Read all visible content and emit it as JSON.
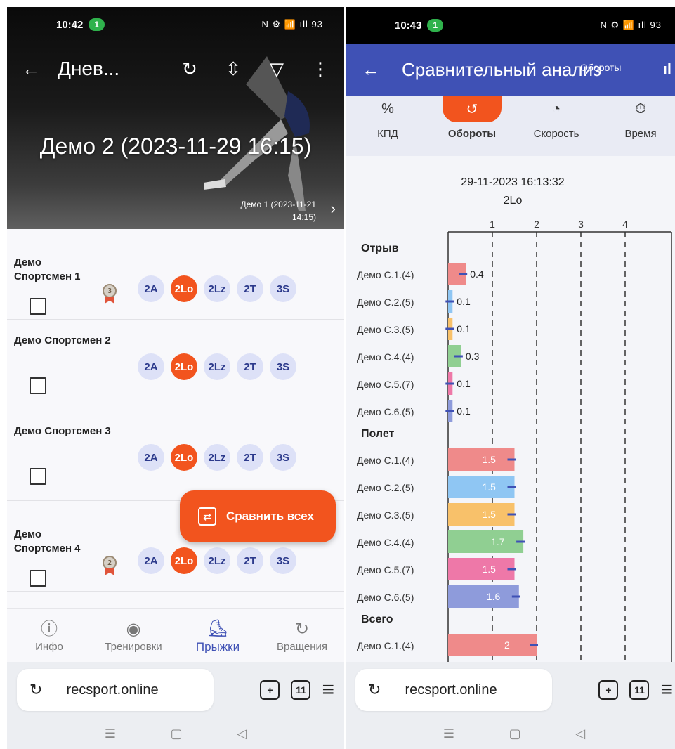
{
  "left": {
    "status": {
      "time": "10:42",
      "pill": "1",
      "icons": "N ⚙ 📶 ıll 93"
    },
    "appbar": {
      "title": "Днев..."
    },
    "hero": {
      "title": "Демо 2 (2023-11-29 16:15)",
      "next_session": "Демо 1 (2023-11-21 14:15)"
    },
    "athletes": [
      {
        "name": "Демо Спортсмен 1",
        "medal": "3",
        "chips": [
          "2A",
          "2Lo",
          "2Lz",
          "2T",
          "3S"
        ],
        "active": 1
      },
      {
        "name": "Демо Спортсмен 2",
        "medal": "",
        "chips": [
          "2A",
          "2Lo",
          "2Lz",
          "2T",
          "3S"
        ],
        "active": 1
      },
      {
        "name": "Демо Спортсмен 3",
        "medal": "",
        "chips": [
          "2A",
          "2Lo",
          "2Lz",
          "2T",
          "3S"
        ],
        "active": 1
      },
      {
        "name": "Демо Спортсмен 4",
        "medal": "2",
        "chips": [
          "2A",
          "2Lo",
          "2Lz",
          "2T",
          "3S"
        ],
        "active": 1
      }
    ],
    "compare_label": "Сравнить всех",
    "nav": [
      {
        "icon": "ⓘ",
        "label": "Инфо",
        "active": false
      },
      {
        "icon": "◉",
        "label": "Тренировки",
        "active": false
      },
      {
        "icon": "⛸",
        "label": "Прыжки",
        "active": true
      },
      {
        "icon": "↻",
        "label": "Вращения",
        "active": false
      }
    ],
    "browser": {
      "url": "recsport.online",
      "tabs": "11"
    }
  },
  "right": {
    "status": {
      "time": "10:43",
      "pill": "1",
      "icons": "N ⚙ 📶 ıll 93"
    },
    "appbar": {
      "title": "Сравнительный анализ",
      "subtag": "Обороты"
    },
    "tabs": [
      {
        "icon": "%",
        "label": "КПД",
        "active": false
      },
      {
        "icon": "↺",
        "label": "Обороты",
        "active": true
      },
      {
        "icon": "◔",
        "label": "Скорость",
        "active": false
      },
      {
        "icon": "⏱",
        "label": "Время",
        "active": false
      }
    ],
    "browser": {
      "url": "recsport.online",
      "tabs": "11"
    }
  },
  "chart_data": {
    "type": "bar",
    "orientation": "horizontal",
    "title": "29-11-2023 16:13:32",
    "subtitle": "2Lo",
    "xticks": [
      1,
      2,
      3,
      4
    ],
    "xlim": [
      0,
      5
    ],
    "grid": "dashed-vertical",
    "groups": [
      {
        "name": "Отрыв",
        "bars": [
          {
            "label": "Демо С.1.(4)",
            "value": 0.4,
            "color": "#ef8a8a"
          },
          {
            "label": "Демо С.2.(5)",
            "value": 0.1,
            "color": "#8fc6f3"
          },
          {
            "label": "Демо С.3.(5)",
            "value": 0.1,
            "color": "#f8c16a"
          },
          {
            "label": "Демо С.4.(4)",
            "value": 0.3,
            "color": "#90cf92"
          },
          {
            "label": "Демо С.5.(7)",
            "value": 0.1,
            "color": "#ee78a8"
          },
          {
            "label": "Демо С.6.(5)",
            "value": 0.1,
            "color": "#8e9bdb"
          }
        ]
      },
      {
        "name": "Полет",
        "bars": [
          {
            "label": "Демо С.1.(4)",
            "value": 1.5,
            "color": "#ef8a8a"
          },
          {
            "label": "Демо С.2.(5)",
            "value": 1.5,
            "color": "#8fc6f3"
          },
          {
            "label": "Демо С.3.(5)",
            "value": 1.5,
            "color": "#f8c16a"
          },
          {
            "label": "Демо С.4.(4)",
            "value": 1.7,
            "color": "#90cf92"
          },
          {
            "label": "Демо С.5.(7)",
            "value": 1.5,
            "color": "#ee78a8"
          },
          {
            "label": "Демо С.6.(5)",
            "value": 1.6,
            "color": "#8e9bdb"
          }
        ]
      },
      {
        "name": "Всего",
        "bars": [
          {
            "label": "Демо С.1.(4)",
            "value": 2,
            "color": "#ef8a8a"
          }
        ]
      }
    ]
  }
}
